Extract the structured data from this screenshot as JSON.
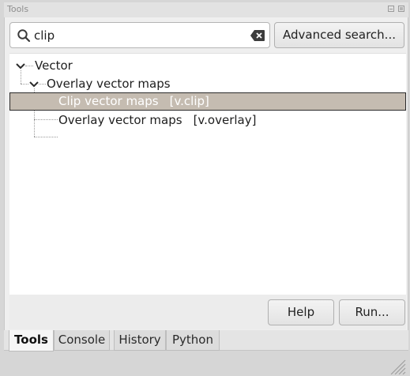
{
  "panel": {
    "title": "Tools"
  },
  "search": {
    "value": "clip",
    "placeholder": ""
  },
  "advanced_button": "Advanced search...",
  "tree": {
    "items": [
      {
        "label": "Vector",
        "command": "",
        "level": 0,
        "expanded": true,
        "selected": false
      },
      {
        "label": "Overlay vector maps",
        "command": "",
        "level": 1,
        "expanded": true,
        "selected": false
      },
      {
        "label": "Clip vector maps",
        "command": "[v.clip]",
        "level": 2,
        "expanded": false,
        "selected": true
      },
      {
        "label": "Overlay vector maps",
        "command": "[v.overlay]",
        "level": 2,
        "expanded": false,
        "selected": false
      }
    ]
  },
  "buttons": {
    "help": "Help",
    "run": "Run..."
  },
  "tabs": [
    {
      "label": "Tools",
      "active": true
    },
    {
      "label": "Console",
      "active": false
    },
    {
      "label": "History",
      "active": false
    },
    {
      "label": "Python",
      "active": false
    }
  ],
  "icons": {
    "search": "search-icon",
    "clear": "clear-icon",
    "expand": "chevron-down-icon",
    "float": "float-panel-icon",
    "close": "close-panel-icon",
    "grip": "resize-grip-icon"
  },
  "colors": {
    "selection_bg": "#c5bcb1",
    "selection_text": "#ffffff",
    "window_bg": "#d6d6d6",
    "tree_bg": "#ffffff"
  }
}
